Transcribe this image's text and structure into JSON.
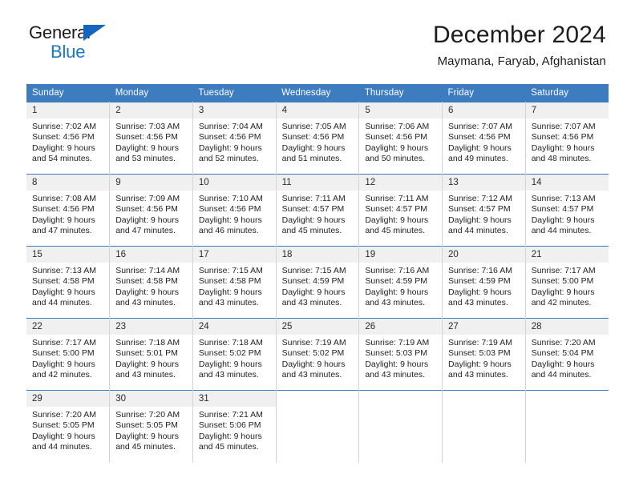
{
  "logo": {
    "line1": "General",
    "line2": "Blue",
    "triangle_color": "#1565c0",
    "text_color": "#1c1c1c",
    "blue_text_color": "#1878c8"
  },
  "header": {
    "title": "December 2024",
    "location": "Maymana, Faryab, Afghanistan"
  },
  "theme": {
    "header_blue": "#3c7cbf",
    "daynum_bg": "#f0f0f0",
    "grid_line": "#d4d4d4",
    "text": "#222222"
  },
  "weekday_headers": [
    "Sunday",
    "Monday",
    "Tuesday",
    "Wednesday",
    "Thursday",
    "Friday",
    "Saturday"
  ],
  "weeks": [
    [
      {
        "day": "1",
        "info": "Sunrise: 7:02 AM\nSunset: 4:56 PM\nDaylight: 9 hours\nand 54 minutes."
      },
      {
        "day": "2",
        "info": "Sunrise: 7:03 AM\nSunset: 4:56 PM\nDaylight: 9 hours\nand 53 minutes."
      },
      {
        "day": "3",
        "info": "Sunrise: 7:04 AM\nSunset: 4:56 PM\nDaylight: 9 hours\nand 52 minutes."
      },
      {
        "day": "4",
        "info": "Sunrise: 7:05 AM\nSunset: 4:56 PM\nDaylight: 9 hours\nand 51 minutes."
      },
      {
        "day": "5",
        "info": "Sunrise: 7:06 AM\nSunset: 4:56 PM\nDaylight: 9 hours\nand 50 minutes."
      },
      {
        "day": "6",
        "info": "Sunrise: 7:07 AM\nSunset: 4:56 PM\nDaylight: 9 hours\nand 49 minutes."
      },
      {
        "day": "7",
        "info": "Sunrise: 7:07 AM\nSunset: 4:56 PM\nDaylight: 9 hours\nand 48 minutes."
      }
    ],
    [
      {
        "day": "8",
        "info": "Sunrise: 7:08 AM\nSunset: 4:56 PM\nDaylight: 9 hours\nand 47 minutes."
      },
      {
        "day": "9",
        "info": "Sunrise: 7:09 AM\nSunset: 4:56 PM\nDaylight: 9 hours\nand 47 minutes."
      },
      {
        "day": "10",
        "info": "Sunrise: 7:10 AM\nSunset: 4:56 PM\nDaylight: 9 hours\nand 46 minutes."
      },
      {
        "day": "11",
        "info": "Sunrise: 7:11 AM\nSunset: 4:57 PM\nDaylight: 9 hours\nand 45 minutes."
      },
      {
        "day": "12",
        "info": "Sunrise: 7:11 AM\nSunset: 4:57 PM\nDaylight: 9 hours\nand 45 minutes."
      },
      {
        "day": "13",
        "info": "Sunrise: 7:12 AM\nSunset: 4:57 PM\nDaylight: 9 hours\nand 44 minutes."
      },
      {
        "day": "14",
        "info": "Sunrise: 7:13 AM\nSunset: 4:57 PM\nDaylight: 9 hours\nand 44 minutes."
      }
    ],
    [
      {
        "day": "15",
        "info": "Sunrise: 7:13 AM\nSunset: 4:58 PM\nDaylight: 9 hours\nand 44 minutes."
      },
      {
        "day": "16",
        "info": "Sunrise: 7:14 AM\nSunset: 4:58 PM\nDaylight: 9 hours\nand 43 minutes."
      },
      {
        "day": "17",
        "info": "Sunrise: 7:15 AM\nSunset: 4:58 PM\nDaylight: 9 hours\nand 43 minutes."
      },
      {
        "day": "18",
        "info": "Sunrise: 7:15 AM\nSunset: 4:59 PM\nDaylight: 9 hours\nand 43 minutes."
      },
      {
        "day": "19",
        "info": "Sunrise: 7:16 AM\nSunset: 4:59 PM\nDaylight: 9 hours\nand 43 minutes."
      },
      {
        "day": "20",
        "info": "Sunrise: 7:16 AM\nSunset: 4:59 PM\nDaylight: 9 hours\nand 43 minutes."
      },
      {
        "day": "21",
        "info": "Sunrise: 7:17 AM\nSunset: 5:00 PM\nDaylight: 9 hours\nand 42 minutes."
      }
    ],
    [
      {
        "day": "22",
        "info": "Sunrise: 7:17 AM\nSunset: 5:00 PM\nDaylight: 9 hours\nand 42 minutes."
      },
      {
        "day": "23",
        "info": "Sunrise: 7:18 AM\nSunset: 5:01 PM\nDaylight: 9 hours\nand 43 minutes."
      },
      {
        "day": "24",
        "info": "Sunrise: 7:18 AM\nSunset: 5:02 PM\nDaylight: 9 hours\nand 43 minutes."
      },
      {
        "day": "25",
        "info": "Sunrise: 7:19 AM\nSunset: 5:02 PM\nDaylight: 9 hours\nand 43 minutes."
      },
      {
        "day": "26",
        "info": "Sunrise: 7:19 AM\nSunset: 5:03 PM\nDaylight: 9 hours\nand 43 minutes."
      },
      {
        "day": "27",
        "info": "Sunrise: 7:19 AM\nSunset: 5:03 PM\nDaylight: 9 hours\nand 43 minutes."
      },
      {
        "day": "28",
        "info": "Sunrise: 7:20 AM\nSunset: 5:04 PM\nDaylight: 9 hours\nand 44 minutes."
      }
    ],
    [
      {
        "day": "29",
        "info": "Sunrise: 7:20 AM\nSunset: 5:05 PM\nDaylight: 9 hours\nand 44 minutes."
      },
      {
        "day": "30",
        "info": "Sunrise: 7:20 AM\nSunset: 5:05 PM\nDaylight: 9 hours\nand 45 minutes."
      },
      {
        "day": "31",
        "info": "Sunrise: 7:21 AM\nSunset: 5:06 PM\nDaylight: 9 hours\nand 45 minutes."
      },
      {
        "day": "",
        "info": ""
      },
      {
        "day": "",
        "info": ""
      },
      {
        "day": "",
        "info": ""
      },
      {
        "day": "",
        "info": ""
      }
    ]
  ]
}
